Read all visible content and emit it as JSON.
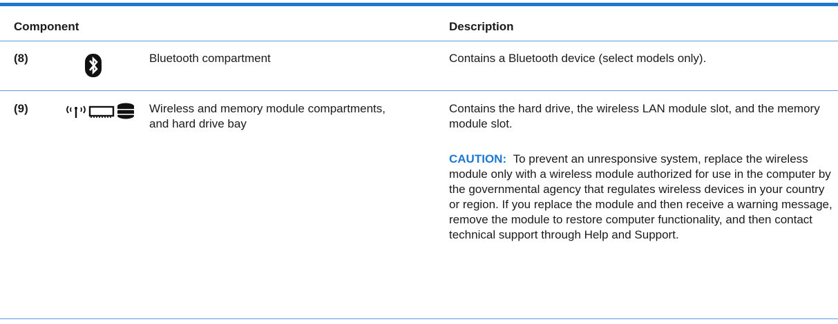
{
  "table": {
    "headers": {
      "component": "Component",
      "description": "Description"
    },
    "rows": [
      {
        "number": "(8)",
        "icon": "bluetooth-icon",
        "component": "Bluetooth compartment",
        "description": "Contains a Bluetooth device (select models only)."
      },
      {
        "number": "(9)",
        "icon": "wireless-memory-drive-icons",
        "component": "Wireless and memory module compartments, and hard drive bay",
        "description": "Contains the hard drive, the wireless LAN module slot, and the memory module slot.",
        "caution_label": "CAUTION:",
        "caution_text": "To prevent an unresponsive system, replace the wireless module only with a wireless module authorized for use in the computer by the governmental agency that regulates wireless devices in your country or region. If you replace the module and then receive a warning message, remove the module to restore computer functionality, and then contact technical support through Help and Support."
      }
    ]
  },
  "colors": {
    "accent": "#1e78d2",
    "rule": "#5b9ae0"
  }
}
